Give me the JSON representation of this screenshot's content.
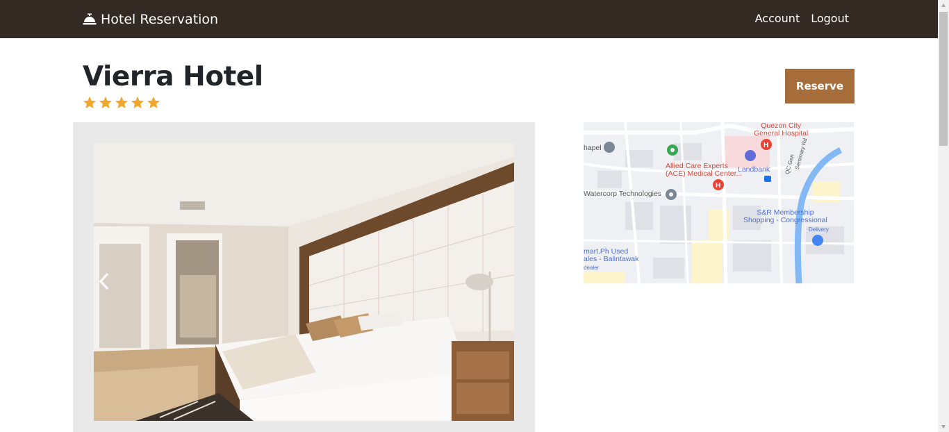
{
  "navbar": {
    "brand": "Hotel Reservation",
    "brand_icon": "concierge-bell-icon",
    "links": [
      "Account",
      "Logout"
    ]
  },
  "hotel": {
    "name": "Vierra Hotel",
    "rating": 5,
    "rating_max": 5
  },
  "actions": {
    "reserve_label": "Reserve"
  },
  "gallery": {
    "prev_icon": "chevron-left-icon"
  },
  "map": {
    "labels": {
      "hospital": "Quezon City\nGeneral Hospital",
      "chapel": "hapel",
      "medical": "Allied Care Experts\n(ACE) Medical Center...",
      "landbank": "Landbank",
      "road_qc": "QC Gen",
      "road_seminary": "Seminary Rd",
      "watercorp": "Watercorp Technologies",
      "snr": "S&R Membership\nShopping - Congressional",
      "delivery": "Delivery",
      "mart": "mart.Ph Used\nales - Balintawak",
      "dealer": "dealer"
    }
  },
  "colors": {
    "navbar": "#332a24",
    "reserve": "#a66d3b",
    "star": "#f0a62c"
  }
}
